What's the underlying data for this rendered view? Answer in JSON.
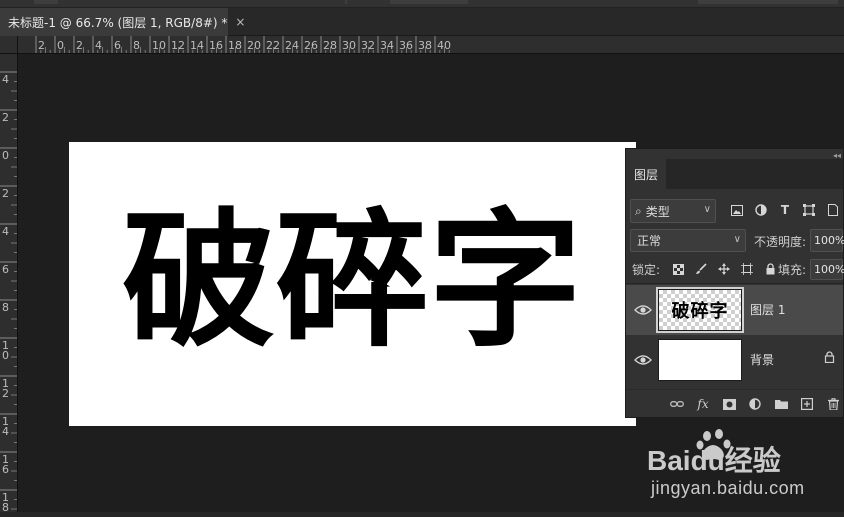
{
  "document_tab": {
    "title": "未标题-1 @ 66.7% (图层 1, RGB/8#) *",
    "close_glyph": "×"
  },
  "rulers": {
    "horizontal_labels": [
      "2",
      "0",
      "2",
      "4",
      "6",
      "8",
      "10",
      "12",
      "14",
      "16",
      "18",
      "20",
      "22",
      "24",
      "26",
      "28",
      "30",
      "32",
      "34",
      "36",
      "38",
      "40"
    ],
    "vertical_labels": [
      "4",
      "2",
      "0",
      "2",
      "4",
      "6",
      "8",
      "10",
      "12",
      "14",
      "16",
      "18"
    ]
  },
  "canvas": {
    "artwork_text": "破碎字",
    "background_color": "#ffffff",
    "text_color": "#000000"
  },
  "layers_panel": {
    "tab_label": "图层",
    "filter": {
      "label": "类型",
      "icons": [
        "image-filter-icon",
        "adjustment-filter-icon",
        "type-filter-icon",
        "shape-filter-icon",
        "smart-object-filter-icon"
      ]
    },
    "blend_mode": "正常",
    "opacity_label": "不透明度:",
    "opacity_value": "100%",
    "lock_label": "锁定:",
    "fill_label": "填充:",
    "fill_value": "100%",
    "layers": [
      {
        "name": "图层 1",
        "thumb_text": "破碎字",
        "selected": true,
        "visible": true,
        "locked": false
      },
      {
        "name": "背景",
        "thumb_text": "",
        "selected": false,
        "visible": true,
        "locked": true
      }
    ]
  },
  "watermark": {
    "brand": "Baidu经验",
    "url": "jingyan.baidu.com"
  }
}
